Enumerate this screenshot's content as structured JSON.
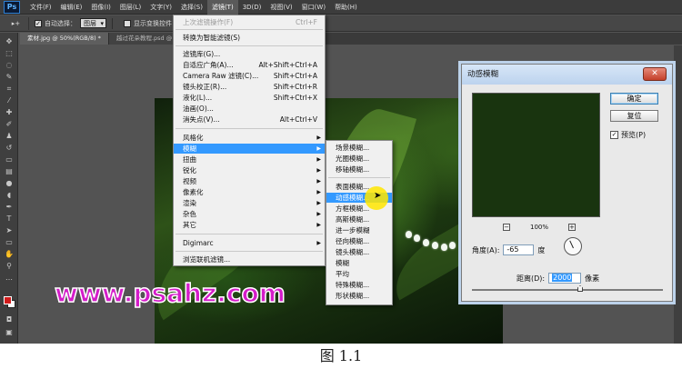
{
  "app": {
    "logo": "Ps"
  },
  "menubar": {
    "items": [
      "文件(F)",
      "编辑(E)",
      "图像(I)",
      "图层(L)",
      "文字(Y)",
      "选择(S)",
      "滤镜(T)",
      "3D(D)",
      "视图(V)",
      "窗口(W)",
      "帮助(H)"
    ],
    "active_index": 6
  },
  "options_bar": {
    "auto_select_label": "自动选择：",
    "auto_select_value": "图层",
    "show_transform_label": "显示变换控件"
  },
  "tabs": [
    {
      "label": "素材.jpg @ 50%(RGB/8) *",
      "active": true
    },
    {
      "label": "越过花朵教程.psd @ 65.2%",
      "active": false
    }
  ],
  "filter_menu": {
    "items": [
      {
        "label": "上次滤镜操作(F)",
        "shortcut": "Ctrl+F",
        "disabled": true
      },
      {
        "separator": true
      },
      {
        "label": "转换为智能滤镜(S)"
      },
      {
        "separator": true
      },
      {
        "label": "滤镜库(G)..."
      },
      {
        "label": "自适应广角(A)...",
        "shortcut": "Alt+Shift+Ctrl+A"
      },
      {
        "label": "Camera Raw 滤镜(C)...",
        "shortcut": "Shift+Ctrl+A"
      },
      {
        "label": "镜头校正(R)...",
        "shortcut": "Shift+Ctrl+R"
      },
      {
        "label": "液化(L)...",
        "shortcut": "Shift+Ctrl+X"
      },
      {
        "label": "油画(O)..."
      },
      {
        "label": "消失点(V)...",
        "shortcut": "Alt+Ctrl+V"
      },
      {
        "separator": true
      },
      {
        "label": "风格化",
        "submenu": true
      },
      {
        "label": "模糊",
        "submenu": true,
        "highlighted": true
      },
      {
        "label": "扭曲",
        "submenu": true
      },
      {
        "label": "锐化",
        "submenu": true
      },
      {
        "label": "视频",
        "submenu": true
      },
      {
        "label": "像素化",
        "submenu": true
      },
      {
        "label": "渲染",
        "submenu": true
      },
      {
        "label": "杂色",
        "submenu": true
      },
      {
        "label": "其它",
        "submenu": true
      },
      {
        "separator": true
      },
      {
        "label": "Digimarc",
        "submenu": true
      },
      {
        "separator": true
      },
      {
        "label": "浏览联机滤镜..."
      }
    ]
  },
  "blur_submenu": {
    "items": [
      {
        "label": "场景模糊..."
      },
      {
        "label": "光圈模糊..."
      },
      {
        "label": "移轴模糊..."
      },
      {
        "separator": true
      },
      {
        "label": "表面模糊..."
      },
      {
        "label": "动感模糊...",
        "highlighted": true
      },
      {
        "label": "方框模糊..."
      },
      {
        "label": "高斯模糊..."
      },
      {
        "label": "进一步模糊"
      },
      {
        "label": "径向模糊..."
      },
      {
        "label": "镜头模糊..."
      },
      {
        "label": "模糊"
      },
      {
        "label": "平均"
      },
      {
        "label": "特殊模糊..."
      },
      {
        "label": "形状模糊..."
      }
    ]
  },
  "dialog": {
    "title": "动感模糊",
    "close": "✕",
    "ok": "确定",
    "reset": "复位",
    "preview_label": "预览(P)",
    "preview_checked": true,
    "zoom": "100%",
    "zoom_minus": "−",
    "zoom_plus": "+",
    "angle_label": "角度(A):",
    "angle_value": "-65",
    "angle_unit": "度",
    "distance_label": "距离(D):",
    "distance_value": "2000",
    "distance_unit": "像素"
  },
  "watermark": "www.psahz.com",
  "caption": "图  1.1",
  "colors": {
    "menu_highlight": "#3399ff",
    "watermark": "#d41cc9",
    "foreground_swatch": "#d21c1c"
  }
}
